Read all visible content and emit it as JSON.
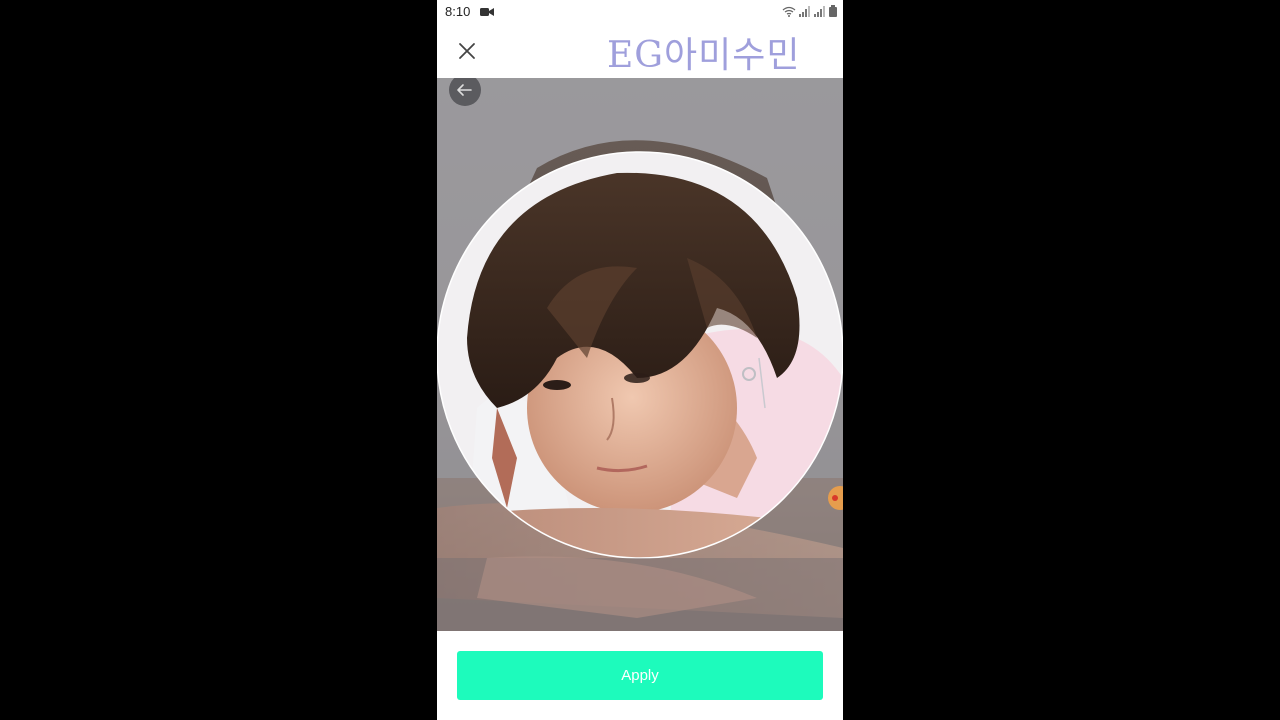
{
  "status_bar": {
    "time": "8:10"
  },
  "header": {
    "close_icon": "close-icon",
    "watermark": "EG아미수민"
  },
  "photo": {
    "back_icon": "arrow-left-icon",
    "crop_shape": "circle",
    "description_colors": {
      "background": "#8a888b",
      "hair": "#3b2a20",
      "skin": "#e2b9a0"
    }
  },
  "footer": {
    "apply_label": "Apply"
  },
  "colors": {
    "accent": "#1dfbbc",
    "watermark": "#8f8fd6",
    "page_bg": "#000000"
  }
}
